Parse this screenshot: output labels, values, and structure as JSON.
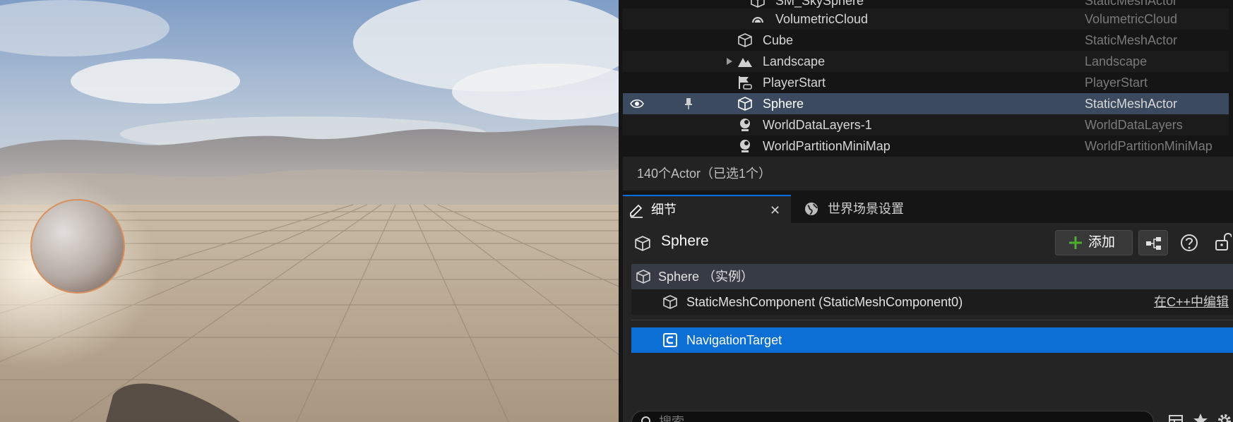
{
  "outliner": {
    "rows": [
      {
        "name": "SM_SkySphere",
        "type": "StaticMeshActor",
        "icon": "static-mesh-icon"
      },
      {
        "name": "VolumetricCloud",
        "type": "VolumetricCloud",
        "icon": "cloud-icon"
      },
      {
        "name": "Cube",
        "type": "StaticMeshActor",
        "icon": "static-mesh-icon"
      },
      {
        "name": "Landscape",
        "type": "Landscape",
        "icon": "landscape-icon"
      },
      {
        "name": "PlayerStart",
        "type": "PlayerStart",
        "icon": "player-start-icon"
      },
      {
        "name": "Sphere",
        "type": "StaticMeshActor",
        "icon": "static-mesh-icon"
      },
      {
        "name": "WorldDataLayers-1",
        "type": "WorldDataLayers",
        "icon": "actor-icon"
      },
      {
        "name": "WorldPartitionMiniMap",
        "type": "WorldPartitionMiniMap",
        "icon": "actor-icon"
      }
    ],
    "status": "140个Actor（已选1个）"
  },
  "tabs": {
    "details": "细节",
    "world_settings": "世界场景设置",
    "close_glyph": "✕"
  },
  "details": {
    "title": "Sphere",
    "add_label": "添加",
    "root_label": "Sphere （实例）",
    "component_label": "StaticMeshComponent (StaticMeshComponent0)",
    "edit_in_cpp": "在C++中编辑",
    "nav_target_label": "NavigationTarget",
    "search_placeholder": "搜索"
  },
  "colors": {
    "selection_outliner": "#3b4a5e",
    "selection_component": "#0b6fd6",
    "tab_accent": "#0070e0",
    "add_plus": "#4caf2f"
  }
}
